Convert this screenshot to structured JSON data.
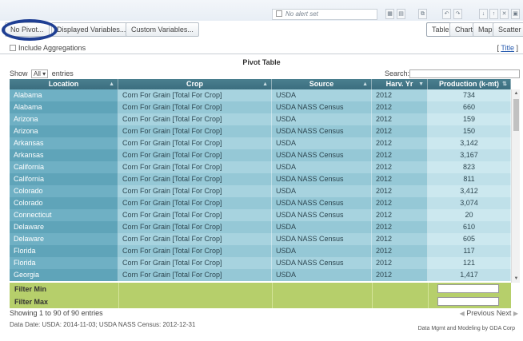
{
  "top": {
    "alert_label": "No alert set",
    "icons": [
      "grid-icon",
      "chart-small-icon",
      "copy-icon",
      "undo-icon",
      "redo-icon",
      "download-icon",
      "upload-icon",
      "close-icon",
      "print-icon"
    ]
  },
  "buttons": {
    "no_pivot": "No Pivot...",
    "displayed_variables": "Displayed Variables...",
    "custom_variables": "Custom Variables...",
    "table": "Table",
    "chart": "Chart",
    "map": "Map",
    "scatter": "Scatter"
  },
  "include_aggregations": "Include Aggregations",
  "title_link": "Title",
  "pivot_title": "Pivot Table",
  "show": {
    "prefix": "Show",
    "value": "All",
    "suffix": "entries"
  },
  "search_label": "Search:",
  "columns": [
    "Location",
    "Crop",
    "Source",
    "Harv. Yr",
    "Production (k-mt)"
  ],
  "rows": [
    [
      "Alabama",
      "Corn For Grain [Total For Crop]",
      "USDA",
      "2012",
      "734"
    ],
    [
      "Alabama",
      "Corn For Grain [Total For Crop]",
      "USDA NASS Census",
      "2012",
      "660"
    ],
    [
      "Arizona",
      "Corn For Grain [Total For Crop]",
      "USDA",
      "2012",
      "159"
    ],
    [
      "Arizona",
      "Corn For Grain [Total For Crop]",
      "USDA NASS Census",
      "2012",
      "150"
    ],
    [
      "Arkansas",
      "Corn For Grain [Total For Crop]",
      "USDA",
      "2012",
      "3,142"
    ],
    [
      "Arkansas",
      "Corn For Grain [Total For Crop]",
      "USDA NASS Census",
      "2012",
      "3,167"
    ],
    [
      "California",
      "Corn For Grain [Total For Crop]",
      "USDA",
      "2012",
      "823"
    ],
    [
      "California",
      "Corn For Grain [Total For Crop]",
      "USDA NASS Census",
      "2012",
      "811"
    ],
    [
      "Colorado",
      "Corn For Grain [Total For Crop]",
      "USDA",
      "2012",
      "3,412"
    ],
    [
      "Colorado",
      "Corn For Grain [Total For Crop]",
      "USDA NASS Census",
      "2012",
      "3,074"
    ],
    [
      "Connecticut",
      "Corn For Grain [Total For Crop]",
      "USDA NASS Census",
      "2012",
      "20"
    ],
    [
      "Delaware",
      "Corn For Grain [Total For Crop]",
      "USDA",
      "2012",
      "610"
    ],
    [
      "Delaware",
      "Corn For Grain [Total For Crop]",
      "USDA NASS Census",
      "2012",
      "605"
    ],
    [
      "Florida",
      "Corn For Grain [Total For Crop]",
      "USDA",
      "2012",
      "117"
    ],
    [
      "Florida",
      "Corn For Grain [Total For Crop]",
      "USDA NASS Census",
      "2012",
      "121"
    ],
    [
      "Georgia",
      "Corn For Grain [Total For Crop]",
      "USDA",
      "2012",
      "1,417"
    ]
  ],
  "filter_min": "Filter Min",
  "filter_max": "Filter Max",
  "showing": "Showing 1 to 90 of 90 entries",
  "pager": {
    "previous": "Previous",
    "next": "Next"
  },
  "data_date": "Data Date: USDA: 2014-11-03; USDA NASS Census: 2012-12-31",
  "credit": "Data Mgmt and Modeling by GDA Corp"
}
